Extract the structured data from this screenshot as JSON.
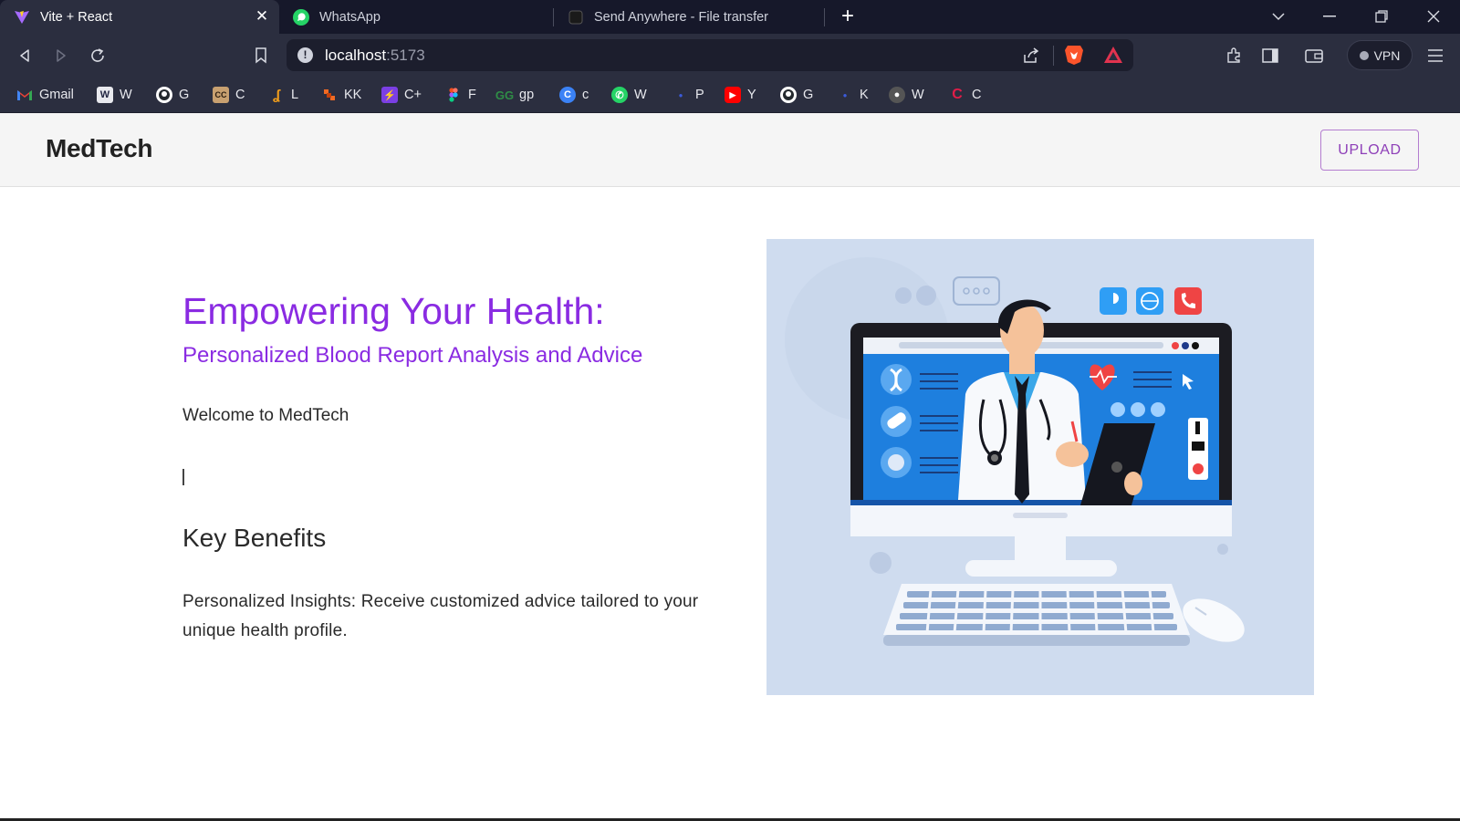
{
  "browser": {
    "tabs": [
      {
        "title": "Vite + React",
        "active": true
      },
      {
        "title": "WhatsApp",
        "active": false
      },
      {
        "title": "Send Anywhere - File transfer",
        "active": false
      }
    ],
    "url_host": "localhost",
    "url_port": ":5173",
    "vpn_label": "VPN",
    "bookmarks": [
      {
        "label": "Gmail",
        "icon": "gmail-icon",
        "color": "#ea4335"
      },
      {
        "label": "W",
        "icon": "w-icon",
        "color": "#1f2340"
      },
      {
        "label": "G",
        "icon": "github-icon",
        "color": "#24292e"
      },
      {
        "label": "C",
        "icon": "cc-icon",
        "color": "#8a6a40"
      },
      {
        "label": "L",
        "icon": "leetcode-icon",
        "color": "#f29e1b"
      },
      {
        "label": "KK",
        "icon": "kk-icon",
        "color": "#f06a23"
      },
      {
        "label": "C+",
        "icon": "bolt-icon",
        "color": "#7b3fe4"
      },
      {
        "label": "F",
        "icon": "figma-icon",
        "color": "#f24e1e"
      },
      {
        "label": "gp",
        "icon": "gp-icon",
        "color": "#2f8d46"
      },
      {
        "label": "c",
        "icon": "c-circle-icon",
        "color": "#3b82f6"
      },
      {
        "label": "W",
        "icon": "whatsapp-icon",
        "color": "#25d366"
      },
      {
        "label": "P",
        "icon": "p-icon",
        "color": "#3b5bdb"
      },
      {
        "label": "Y",
        "icon": "youtube-icon",
        "color": "#ff0000"
      },
      {
        "label": "G",
        "icon": "github-icon",
        "color": "#24292e"
      },
      {
        "label": "K",
        "icon": "k-icon",
        "color": "#3b5bdb"
      },
      {
        "label": "W",
        "icon": "w-dark-icon",
        "color": "#444444"
      },
      {
        "label": "C",
        "icon": "c-red-icon",
        "color": "#e11d48"
      }
    ]
  },
  "page": {
    "brand": "MedTech",
    "upload_label": "UPLOAD",
    "hero_title": "Empowering Your Health:",
    "hero_subtitle": "Personalized Blood Report Analysis and Advice",
    "welcome": "Welcome to MedTech",
    "key_benefits_title": "Key Benefits",
    "key_benefits_text": "Personalized Insights: Receive customized advice tailored to your unique health profile."
  },
  "colors": {
    "accent": "#8a2be2",
    "illustration_bg": "#cfdcef",
    "screen_blue": "#1e88e5"
  }
}
